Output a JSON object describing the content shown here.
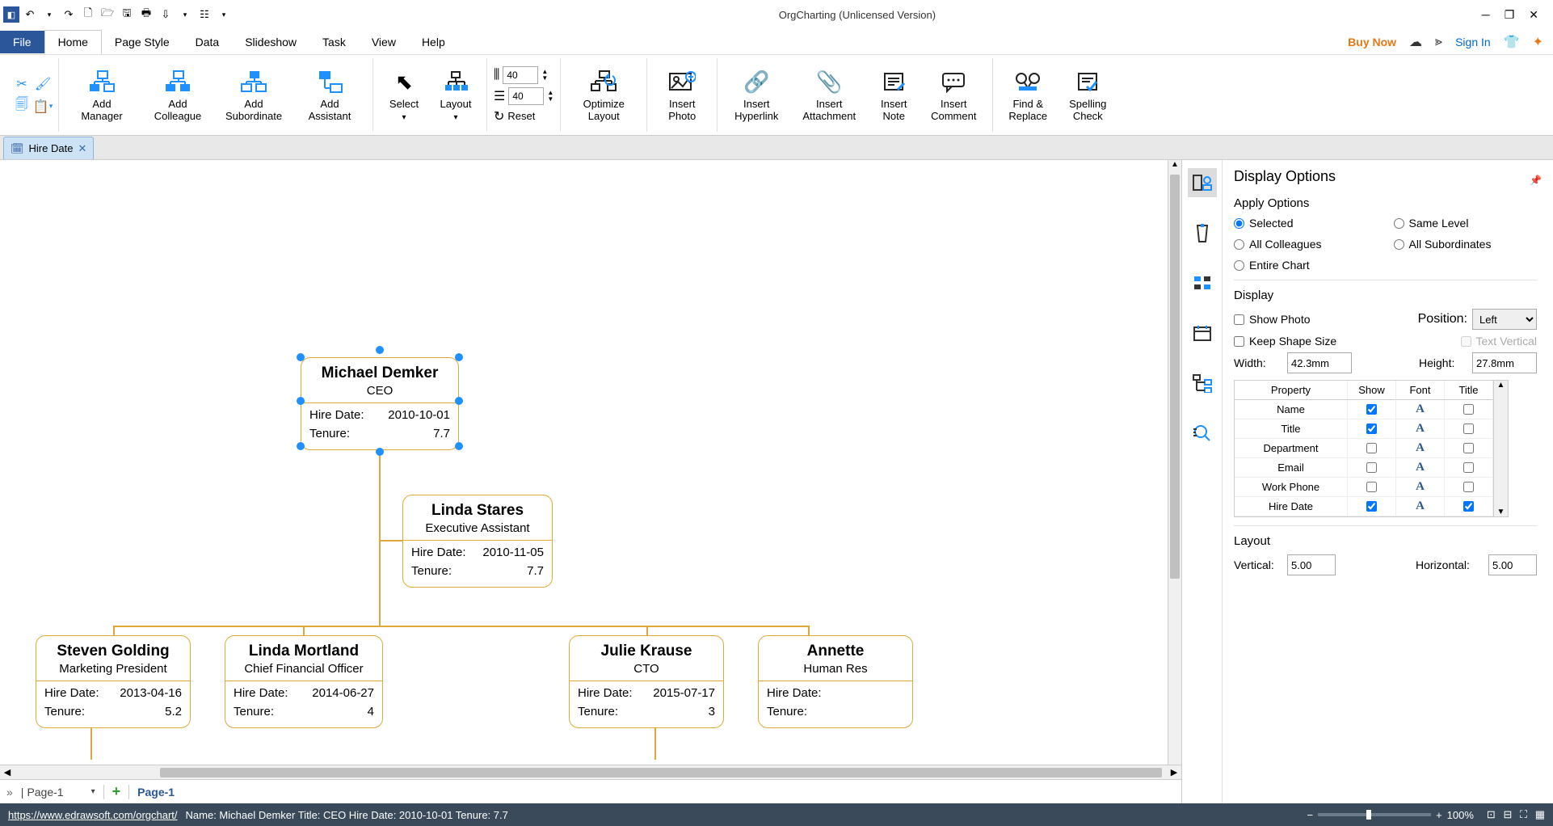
{
  "title": "OrgCharting (Unlicensed Version)",
  "menu": {
    "file": "File",
    "home": "Home",
    "pagestyle": "Page Style",
    "data": "Data",
    "slideshow": "Slideshow",
    "task": "Task",
    "view": "View",
    "help": "Help",
    "buy": "Buy Now",
    "signin": "Sign In"
  },
  "ribbon": {
    "addManager": "Add\nManager",
    "addColleague": "Add\nColleague",
    "addSubordinate": "Add\nSubordinate",
    "addAssistant": "Add\nAssistant",
    "select": "Select",
    "layout": "Layout",
    "optimize": "Optimize\nLayout",
    "insertPhoto": "Insert\nPhoto",
    "insertHyperlink": "Insert\nHyperlink",
    "insertAttachment": "Insert\nAttachment",
    "insertNote": "Insert\nNote",
    "insertComment": "Insert\nComment",
    "findReplace": "Find &\nReplace",
    "spelling": "Spelling\nCheck",
    "reset": "Reset",
    "spin1": "40",
    "spin2": "40"
  },
  "doctab": "Hire Date",
  "org": {
    "root": {
      "name": "Michael Demker",
      "title": "CEO",
      "hire": "2010-10-01",
      "tenure": "7.7",
      "hireLbl": "Hire Date:",
      "tenLbl": "Tenure:"
    },
    "assistant": {
      "name": "Linda Stares",
      "title": "Executive Assistant",
      "hire": "2010-11-05",
      "tenure": "7.7"
    },
    "c1": {
      "name": "Steven Golding",
      "title": "Marketing President",
      "hire": "2013-04-16",
      "tenure": "5.2"
    },
    "c2": {
      "name": "Linda Mortland",
      "title": "Chief Financial Officer",
      "hire": "2014-06-27",
      "tenure": "4"
    },
    "c3": {
      "name": "Julie Krause",
      "title": "CTO",
      "hire": "2015-07-17",
      "tenure": "3"
    },
    "c4": {
      "name": "Annette",
      "title": "Human Res",
      "hire": "",
      "tenure": ""
    }
  },
  "pane": {
    "title": "Display Options",
    "apply": "Apply Options",
    "opts": {
      "selected": "Selected",
      "sameLevel": "Same Level",
      "allColleagues": "All Colleagues",
      "allSubs": "All Subordinates",
      "entire": "Entire Chart"
    },
    "display": "Display",
    "showPhoto": "Show Photo",
    "position": "Position:",
    "posVal": "Left",
    "keepShape": "Keep Shape Size",
    "textVert": "Text Vertical",
    "width": "Width:",
    "widthVal": "42.3mm",
    "height": "Height:",
    "heightVal": "27.8mm",
    "hdrs": {
      "property": "Property",
      "show": "Show",
      "font": "Font",
      "titleCol": "Title"
    },
    "rows": [
      {
        "p": "Name",
        "show": true,
        "title": false
      },
      {
        "p": "Title",
        "show": true,
        "title": false
      },
      {
        "p": "Department",
        "show": false,
        "title": false
      },
      {
        "p": "Email",
        "show": false,
        "title": false
      },
      {
        "p": "Work Phone",
        "show": false,
        "title": false
      },
      {
        "p": "Hire Date",
        "show": true,
        "title": true
      }
    ],
    "layout": "Layout",
    "vertical": "Vertical:",
    "vVal": "5.00",
    "horizontal": "Horizontal:",
    "hVal": "5.00"
  },
  "pagerow": {
    "page": "Page-1",
    "tab": "Page-1"
  },
  "status": {
    "url": "https://www.edrawsoft.com/orgchart/",
    "info": "Name: Michael Demker  Title: CEO  Hire Date: 2010-10-01  Tenure: 7.7",
    "zoom": "100%"
  },
  "hireLbl": "Hire Date:",
  "tenLbl": "Tenure:"
}
